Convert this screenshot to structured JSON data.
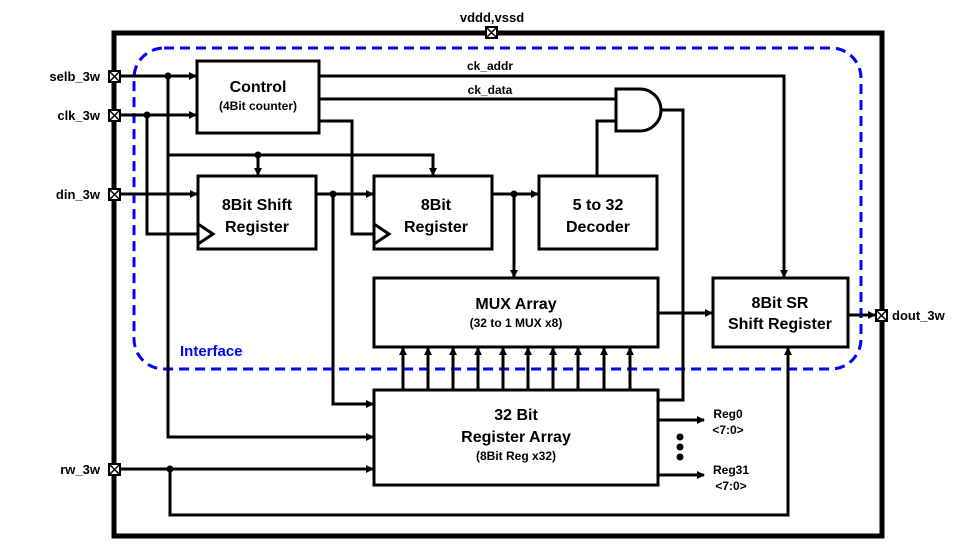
{
  "colors": {
    "interface_boundary": "#0000ff",
    "wire": "#000000"
  },
  "power_pin": "vddd,vssd",
  "pins": {
    "selb": "selb_3w",
    "clk": "clk_3w",
    "din": "din_3w",
    "rw": "rw_3w",
    "dout": "dout_3w"
  },
  "interface_label": "Interface",
  "blocks": {
    "control": {
      "title": "Control",
      "subtitle": "(4Bit counter)"
    },
    "shift_register": {
      "line1": "8Bit Shift",
      "line2": "Register"
    },
    "register": {
      "line1": "8Bit",
      "line2": "Register"
    },
    "decoder": {
      "line1": "5 to 32",
      "line2": "Decoder"
    },
    "mux_array": {
      "title": "MUX Array",
      "subtitle": "(32 to 1 MUX x8)"
    },
    "sr_shift_register": {
      "line1": "8Bit SR",
      "line2": "Shift Register"
    },
    "register_array": {
      "line1": "32 Bit",
      "line2": "Register Array",
      "subtitle": "(8Bit Reg x32)"
    }
  },
  "signals": {
    "ck_addr": "ck_addr",
    "ck_data": "ck_data"
  },
  "outputs": {
    "reg0": {
      "name": "Reg0",
      "bits": "<7:0>"
    },
    "reg31": {
      "name": "Reg31",
      "bits": "<7:0>"
    }
  },
  "icons": {
    "pin": "boxed-x-pad-icon",
    "gate": "and-gate-icon"
  }
}
